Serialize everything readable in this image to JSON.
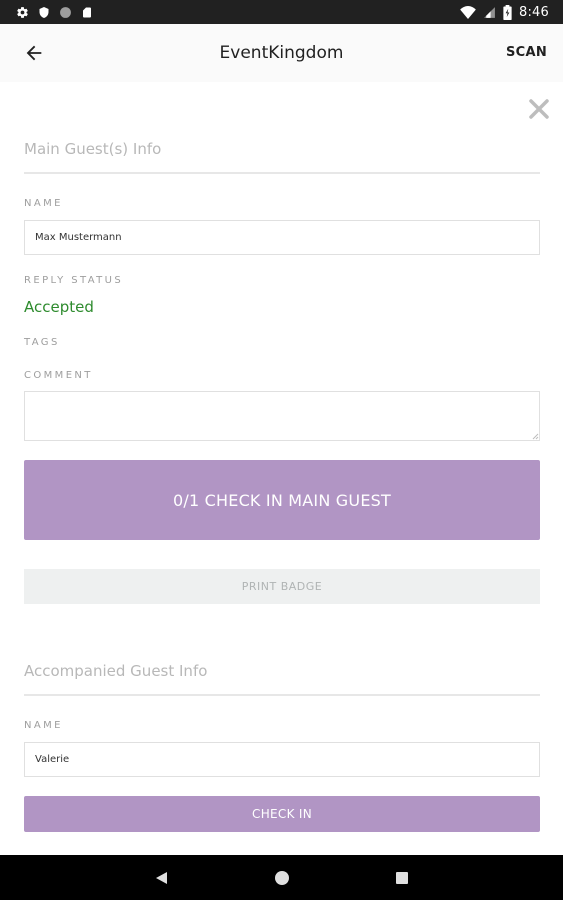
{
  "status_bar": {
    "time": "8:46",
    "left_icons": [
      "gear-icon",
      "shield-icon",
      "circle-icon",
      "sd-card-icon"
    ],
    "right_icons": [
      "wifi-icon",
      "signal-icon",
      "battery-icon"
    ]
  },
  "app_bar": {
    "title": "EventKingdom",
    "action": "SCAN",
    "back_icon": "arrow-left-icon"
  },
  "main_guest": {
    "section_title": "Main Guest(s) Info",
    "name_label": "NAME",
    "name_value": "Max Mustermann",
    "reply_status_label": "REPLY STATUS",
    "reply_status_value": "Accepted",
    "tags_label": "TAGS",
    "comment_label": "COMMENT",
    "comment_value": "",
    "check_in_button": "0/1 CHECK IN MAIN GUEST",
    "print_badge_button": "PRINT BADGE"
  },
  "accompanied_guest": {
    "section_title": "Accompanied Guest Info",
    "name_label": "NAME",
    "name_value": "Valerie",
    "check_in_button": "CHECK IN"
  },
  "colors": {
    "accent": "#b195c4",
    "status_accepted": "#2e8b2e",
    "badge_button_bg": "#eef0f0"
  }
}
